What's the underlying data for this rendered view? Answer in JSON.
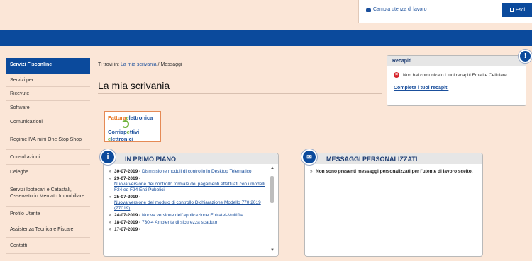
{
  "header": {
    "workplace_label": "Cambia utenza di lavoro",
    "exit_label": "Esci"
  },
  "sidebar": {
    "items": [
      {
        "label": "Servizi Fisconline"
      },
      {
        "label": "Servizi per"
      },
      {
        "label": "Ricevute"
      },
      {
        "label": "Software"
      },
      {
        "label": "Comunicazioni"
      },
      {
        "label": "Regime IVA mini One Stop Shop"
      },
      {
        "label": "Consultazioni"
      },
      {
        "label": "Deleghe"
      },
      {
        "label": "Servizi Ipotecari e Catastali, Osservatorio Mercato Immobiliare"
      },
      {
        "label": "Profilo Utente"
      },
      {
        "label": "Assistenza Tecnica e Fiscale"
      },
      {
        "label": "Contatti"
      }
    ]
  },
  "breadcrumb": {
    "prefix": "Ti trovi in:",
    "link": "La mia scrivania",
    "separator": "/",
    "current": "Messaggi"
  },
  "page": {
    "title": "La mia scrivania"
  },
  "logo": {
    "line1_a": "Fattura",
    "line1_b": "lettronica",
    "line2_a": "Corrisp",
    "line2_b": "ttivi",
    "line2_c": "lettronici"
  },
  "primo_piano": {
    "title": "IN PRIMO PIANO",
    "items": [
      {
        "date": "30-07-2019 -",
        "text": "Dismissione moduli di controllo in Desktop Telematico"
      },
      {
        "date": "29-07-2019 -",
        "text": "Nuova versione dei controllo formale dei pagamenti effettuati con i modelli F24 ed F24 Enti Pubblici"
      },
      {
        "date": "25-07-2019 -",
        "text": "Nuova versione del modulo di controllo Dichiarazione Modello 770 2019 (77019)"
      },
      {
        "date": "24-07-2019 -",
        "text": "Nuova versione dell'applicazione Entratel-Multifile"
      },
      {
        "date": "18-07-2019 -",
        "text": "730-4 Ambiente di sicurezza scaduto"
      },
      {
        "date": "17-07-2019 -",
        "text": ""
      }
    ]
  },
  "messaggi": {
    "title": "MESSAGGI PERSONALIZZATI",
    "text": "Non sono presenti messaggi personalizzati per l'utente di lavoro scelto."
  },
  "recapiti": {
    "title": "Recapiti",
    "warning": "Non hai comunicato i tuoi recapiti Email e Cellulare",
    "link": "Completa i tuoi recapiti"
  },
  "colors": {
    "brand_blue": "#0b4a9c",
    "background": "#fbe6d7",
    "link": "#1a4f9c",
    "alert_red": "#d6232a"
  }
}
